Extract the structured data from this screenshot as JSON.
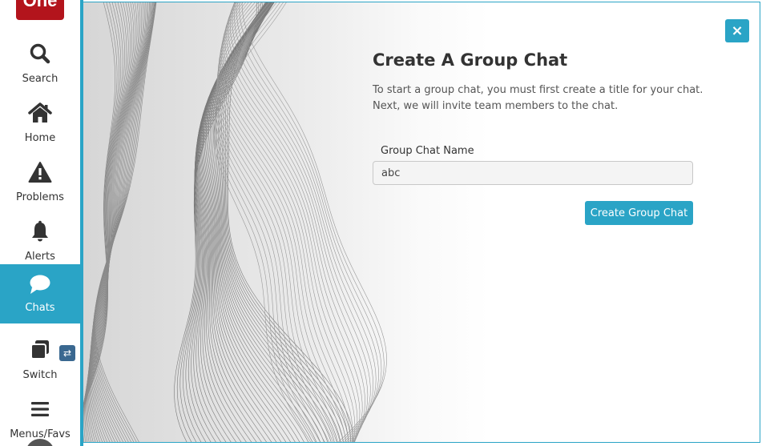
{
  "sidebar": {
    "logo_text": "One",
    "items": [
      {
        "label": "Search",
        "icon": "search-icon"
      },
      {
        "label": "Home",
        "icon": "home-icon"
      },
      {
        "label": "Problems",
        "icon": "warning-icon"
      },
      {
        "label": "Alerts",
        "icon": "bell-icon"
      },
      {
        "label": "Chats",
        "icon": "chat-bubble-icon",
        "active": true
      },
      {
        "label": "Switch",
        "icon": "windows-icon",
        "badge_icon": "swap-arrows-icon",
        "badge_text": "⇄"
      },
      {
        "label": "Menus/Favs",
        "icon": "hamburger-menu-icon"
      }
    ]
  },
  "dialog": {
    "close_label": "×",
    "title": "Create A Group Chat",
    "description_line1": "To start a group chat, you must first create a title for your chat.",
    "description_line2": "Next, we will invite team members to the chat.",
    "field_label": "Group Chat Name",
    "field_value": "abc",
    "submit_label": "Create Group Chat"
  },
  "colors": {
    "accent": "#2aa4c6",
    "logo": "#b3141c",
    "switch_badge": "#3a6890"
  }
}
